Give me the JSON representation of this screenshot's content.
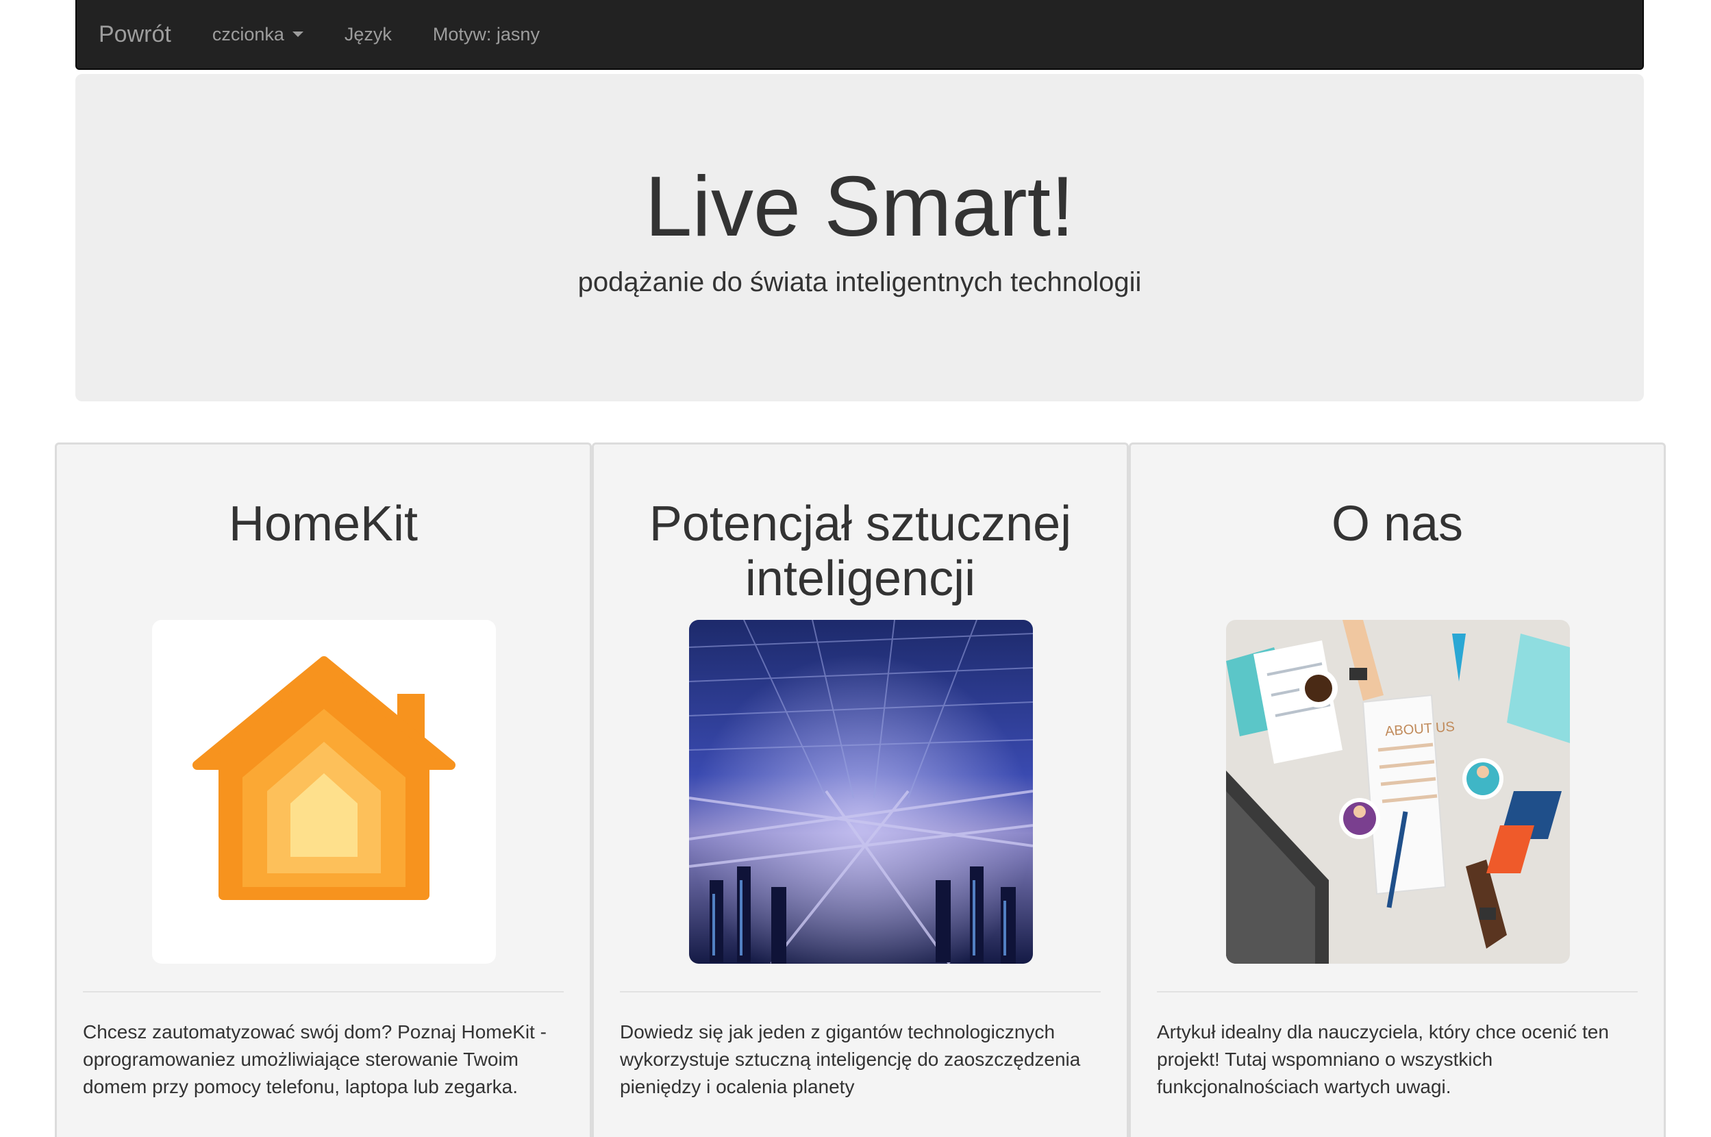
{
  "navbar": {
    "brand": "Powrót",
    "items": [
      {
        "label": "czcionka",
        "dropdown": true
      },
      {
        "label": "Język"
      },
      {
        "label": "Motyw: jasny"
      }
    ]
  },
  "hero": {
    "title": "Live Smart!",
    "subtitle": "podążanie do świata inteligentnych technologii"
  },
  "cards": [
    {
      "title": "HomeKit",
      "icon": "homekit-house-icon",
      "description": "Chcesz zautomatyzować swój dom? Poznaj HomeKit - oprogramowaniez umożliwiające sterowanie Twoim domem przy pomocy telefonu, laptopa lub zegarka."
    },
    {
      "title": "Potencjał sztucznej inteligencji",
      "icon": "data-center-image",
      "description": "Dowiedz się jak jeden z gigantów technologicznych wykorzystuje sztuczną inteligencję do zaoszczędzenia pieniędzy i ocalenia planety"
    },
    {
      "title": "O nas",
      "icon": "about-us-illustration",
      "image_text": "ABOUT US",
      "description": "Artykuł idealny dla nauczyciela, który chce ocenić ten projekt! Tutaj wspomniano o wszystkich funkcjonalnościach wartych uwagi."
    }
  ],
  "colors": {
    "navbar_bg": "#222222",
    "navbar_text": "#9d9d9d",
    "jumbotron_bg": "#eeeeee",
    "card_bg": "#f4f4f4"
  }
}
